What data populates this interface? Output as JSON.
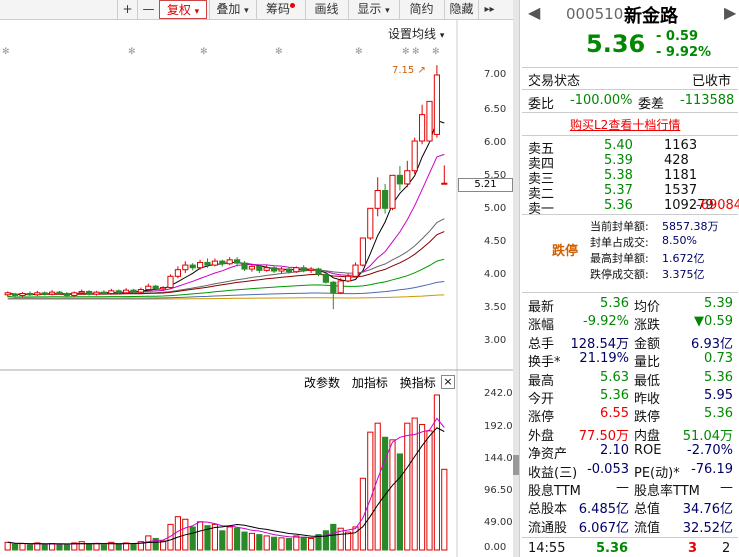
{
  "toolbar": {
    "plus": "+",
    "minus": "—",
    "fuquan": "复权",
    "diejia": "叠加",
    "chouma": "筹码",
    "huaxian": "画线",
    "xianshi": "显示",
    "jianyue": "简约",
    "yincang": "隐藏",
    "more": "▸▸"
  },
  "chart": {
    "ma_setting": "设置均线",
    "high_annot": "7.15",
    "price_ticks": [
      "7.00",
      "6.50",
      "6.00",
      "5.50",
      "5.00",
      "4.50",
      "4.00",
      "3.50",
      "3.00"
    ],
    "current_price_marker": "5.21",
    "indicator_buttons": {
      "gai_canshu": "改参数",
      "jia_zhibiao": "加指标",
      "huan_zhibiao": "换指标",
      "close": "×"
    },
    "vol_ticks": [
      "242.00",
      "192.00",
      "144.00",
      "96.50",
      "49.00",
      "0.00"
    ]
  },
  "quote": {
    "code": "000510",
    "name": "新金路",
    "price": "5.36",
    "change": "- 0.59",
    "change_pct": "- 9.92%",
    "status_label": "交易状态",
    "status_value": "已收市",
    "weibi_label": "委比",
    "weibi_value": "-100.00%",
    "weicha_label": "委差",
    "weicha_value": "-113588",
    "l2_link": "购买L2查看十档行情",
    "orders": [
      {
        "label": "卖五",
        "price": "5.40",
        "vol": "1163",
        "extra": ""
      },
      {
        "label": "卖四",
        "price": "5.39",
        "vol": "428",
        "extra": ""
      },
      {
        "label": "卖三",
        "price": "5.38",
        "vol": "1181",
        "extra": ""
      },
      {
        "label": "卖二",
        "price": "5.37",
        "vol": "1537",
        "extra": ""
      },
      {
        "label": "卖一",
        "price": "5.36",
        "vol": "109279",
        "extra": "-69084"
      }
    ],
    "limit": {
      "tag": "跌停",
      "rows": [
        {
          "label": "当前封单额:",
          "value": "5857.38万"
        },
        {
          "label": "封单占成交:",
          "value": "8.50%"
        },
        {
          "label": "最高封单额:",
          "value": "1.672亿"
        },
        {
          "label": "跌停成交额:",
          "value": "3.375亿"
        }
      ]
    },
    "stats": [
      {
        "l1": "最新",
        "v1": "5.36",
        "c1": "grn",
        "l2": "均价",
        "v2": "5.39",
        "c2": "grn"
      },
      {
        "l1": "涨幅",
        "v1": "-9.92%",
        "c1": "grn",
        "l2": "涨跌",
        "v2": "▼0.59",
        "c2": "grn"
      },
      {
        "l1": "总手",
        "v1": "128.54万",
        "c1": "blu",
        "l2": "金额",
        "v2": "6.93亿",
        "c2": "blu"
      },
      {
        "l1": "换手*",
        "v1": "21.19%",
        "c1": "blu",
        "l2": "量比",
        "v2": "0.73",
        "c2": "grn"
      },
      {
        "l1": "最高",
        "v1": "5.63",
        "c1": "grn",
        "l2": "最低",
        "v2": "5.36",
        "c2": "grn"
      },
      {
        "l1": "今开",
        "v1": "5.36",
        "c1": "grn",
        "l2": "昨收",
        "v2": "5.95",
        "c2": "blu"
      },
      {
        "l1": "涨停",
        "v1": "6.55",
        "c1": "red",
        "l2": "跌停",
        "v2": "5.36",
        "c2": "grn"
      },
      {
        "l1": "外盘",
        "v1": "77.50万",
        "c1": "red",
        "l2": "内盘",
        "v2": "51.04万",
        "c2": "grn"
      },
      {
        "l1": "净资产",
        "v1": "2.10",
        "c1": "blu",
        "l2": "ROE",
        "v2": "-2.70%",
        "c2": "blu"
      },
      {
        "l1": "收益(三)",
        "v1": "-0.053",
        "c1": "blu",
        "l2": "PE(动)*",
        "v2": "-76.19",
        "c2": "blu"
      },
      {
        "l1": "股息TTM",
        "v1": "—",
        "c1": "blu",
        "l2": "股息率TTM",
        "v2": "—",
        "c2": "blu"
      },
      {
        "l1": "总股本",
        "v1": "6.485亿",
        "c1": "blu",
        "l2": "总值",
        "v2": "34.76亿",
        "c2": "blu"
      },
      {
        "l1": "流通股",
        "v1": "6.067亿",
        "c1": "blu",
        "l2": "流值",
        "v2": "32.52亿",
        "c2": "blu"
      }
    ],
    "tick": {
      "time": "14:55",
      "price": "5.36",
      "vol": "3",
      "count": "2"
    }
  },
  "colors": {
    "up": "#e00000",
    "down": "#2a8a2a",
    "accent": "#d08030"
  }
}
